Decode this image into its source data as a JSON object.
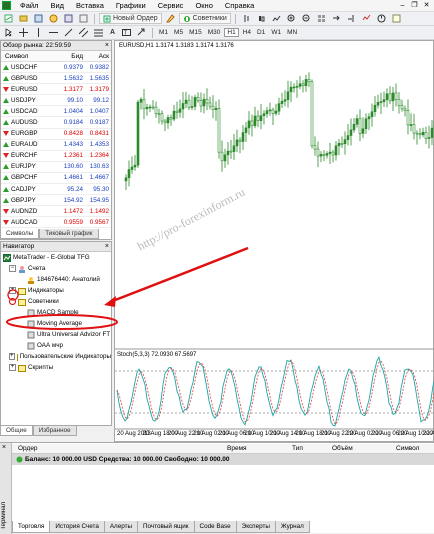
{
  "menu": [
    "Файл",
    "Вид",
    "Вставка",
    "Графики",
    "Сервис",
    "Окно",
    "Справка"
  ],
  "toolbar": {
    "new_order": "Новый Ордер",
    "advisors": "Советники",
    "timeframes": [
      "M1",
      "M5",
      "M15",
      "M30",
      "H1",
      "H4",
      "D1",
      "W1",
      "MN"
    ]
  },
  "market_watch": {
    "title": "Обзор рынка: 22:59:59",
    "columns": [
      "Символ",
      "Бид",
      "Аск"
    ],
    "rows": [
      {
        "symbol": "USDCHF",
        "bid": "0.9379",
        "ask": "0.9382",
        "dir": "up"
      },
      {
        "symbol": "GBPUSD",
        "bid": "1.5632",
        "ask": "1.5635",
        "dir": "up"
      },
      {
        "symbol": "EURUSD",
        "bid": "1.3177",
        "ask": "1.3179",
        "dir": "dn"
      },
      {
        "symbol": "USDJPY",
        "bid": "99.10",
        "ask": "99.12",
        "dir": "up"
      },
      {
        "symbol": "USDCAD",
        "bid": "1.0404",
        "ask": "1.0407",
        "dir": "up"
      },
      {
        "symbol": "AUDUSD",
        "bid": "0.9184",
        "ask": "0.9187",
        "dir": "up"
      },
      {
        "symbol": "EURGBP",
        "bid": "0.8428",
        "ask": "0.8431",
        "dir": "dn"
      },
      {
        "symbol": "EURAUD",
        "bid": "1.4343",
        "ask": "1.4353",
        "dir": "up"
      },
      {
        "symbol": "EURCHF",
        "bid": "1.2361",
        "ask": "1.2364",
        "dir": "dn"
      },
      {
        "symbol": "EURJPY",
        "bid": "130.60",
        "ask": "130.63",
        "dir": "up"
      },
      {
        "symbol": "GBPCHF",
        "bid": "1.4661",
        "ask": "1.4667",
        "dir": "up"
      },
      {
        "symbol": "CADJPY",
        "bid": "95.24",
        "ask": "95.30",
        "dir": "up"
      },
      {
        "symbol": "GBPJPY",
        "bid": "154.92",
        "ask": "154.95",
        "dir": "up"
      },
      {
        "symbol": "AUDNZD",
        "bid": "1.1472",
        "ask": "1.1492",
        "dir": "dn"
      },
      {
        "symbol": "AUDCAD",
        "bid": "0.9559",
        "ask": "0.9567",
        "dir": "dn"
      }
    ],
    "tabs": [
      "Символы",
      "Тиковый график"
    ]
  },
  "navigator": {
    "title": "Навигатор",
    "root": "MetaTrader - E-Global TFG",
    "accounts": "Счета",
    "account": "184676440: Анатолий",
    "indicators": "Индикаторы",
    "advisors": "Советники",
    "ea_items": [
      "MACD Sample",
      "Moving Average",
      "Ultra Universal Advizor FT",
      "ОАА мчр"
    ],
    "custom_indicators": "Пользовательские Индикаторы",
    "scripts": "Скрипты",
    "tabs": [
      "Общие",
      "Избранное"
    ]
  },
  "chart": {
    "symbol_label": "EURUSD,H1  1.3174 1.3183 1.3174 1.3176",
    "stoch_label": "Stoch(5,3,3) 72.0930 67.5697",
    "watermark": "http://pro-forexinform.ru",
    "x_labels": [
      "20 Aug 2013",
      "20 Aug 18:00",
      "20 Aug 22:00",
      "21 Aug 02:00",
      "21 Aug 06:00",
      "21 Aug 10:00",
      "21 Aug 14:00",
      "21 Aug 18:00",
      "21 Aug 22:00",
      "22 Aug 02:00",
      "22 Aug 06:00",
      "22 Aug 10:00",
      "22 Au"
    ]
  },
  "terminal": {
    "columns": [
      "Ордер",
      "Время",
      "Тип",
      "Объём",
      "Символ"
    ],
    "balance": "Баланс: 10 000.00 USD  Средства: 10 000.00  Свободно: 10 000.00",
    "side_label": "Терминал",
    "tabs": [
      "Торговля",
      "История Счета",
      "Алерты",
      "Почтовый ящик",
      "Code Base",
      "Эксперты",
      "Журнал"
    ]
  }
}
